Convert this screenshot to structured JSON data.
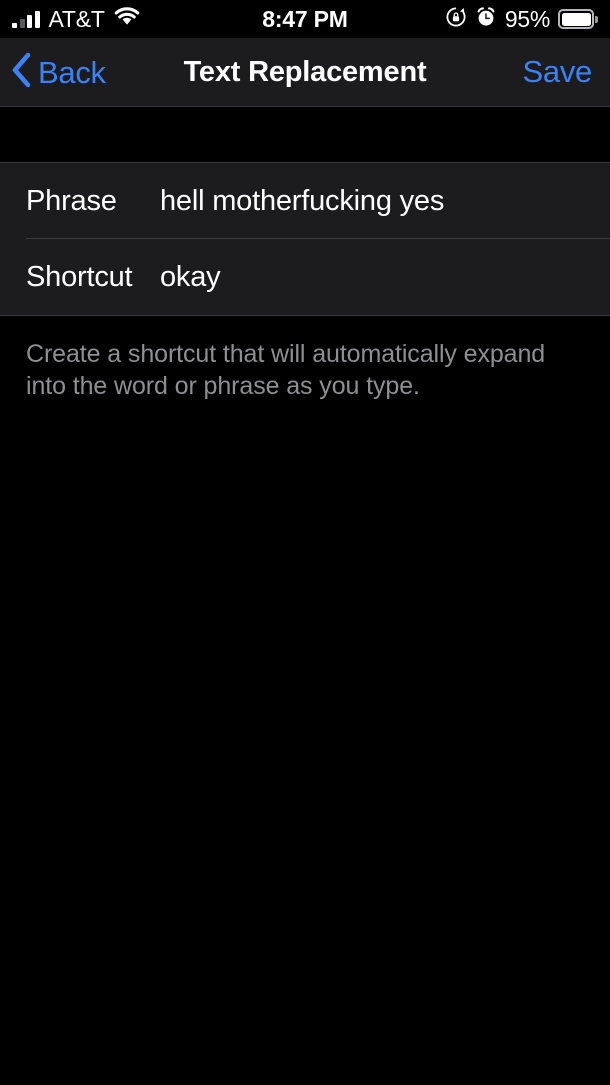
{
  "status_bar": {
    "carrier": "AT&T",
    "signal_icon": "cellular-signal-icon",
    "signal_bars_total": 4,
    "signal_bars_active": 3,
    "wifi_icon": "wifi-icon",
    "time": "8:47 PM",
    "rotation_lock_icon": "rotation-lock-icon",
    "alarm_icon": "alarm-clock-icon",
    "battery_percent": "95%",
    "battery_icon": "battery-icon",
    "battery_level": 95
  },
  "nav_bar": {
    "back_label": "Back",
    "back_icon": "chevron-left-icon",
    "title": "Text Replacement",
    "save_label": "Save"
  },
  "form": {
    "rows": [
      {
        "label": "Phrase",
        "value": "hell motherfucking yes",
        "placeholder": "Phrase"
      },
      {
        "label": "Shortcut",
        "value": "okay",
        "placeholder": "Shortcut"
      }
    ]
  },
  "footer": {
    "note": "Create a shortcut that will automatically expand into the word or phrase as you type."
  },
  "colors": {
    "accent_blue": "#3b82f6",
    "background": "#000000",
    "cell_background": "#1c1c1e",
    "separator": "#3a3a3c",
    "secondary_text": "#8e8e93"
  }
}
